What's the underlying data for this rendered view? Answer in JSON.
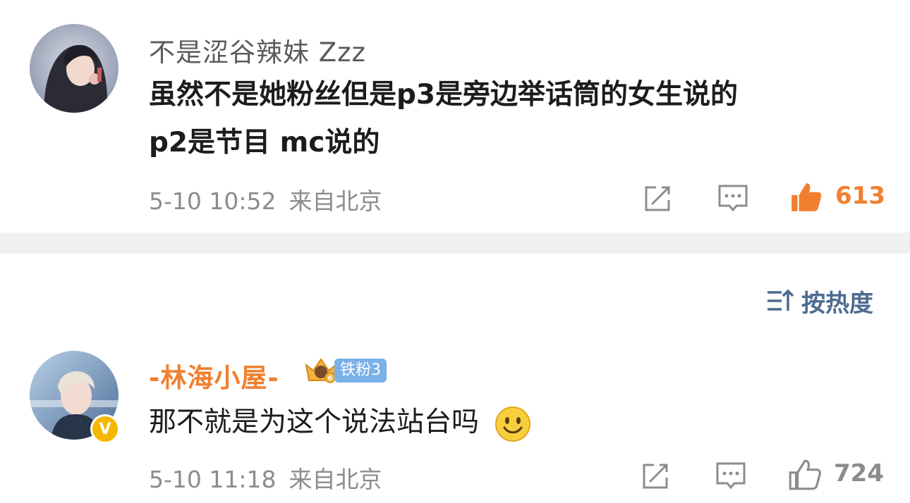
{
  "comments": [
    {
      "username": "不是涩谷辣妹 Zzz",
      "text_lines": [
        "虽然不是她粉丝但是p3是旁边举话筒的女生说的",
        "p2是节目 mc说的"
      ],
      "time": "5-10 10:52",
      "location": "来自北京",
      "likes": "613",
      "liked": true
    },
    {
      "username": "-林海小屋-",
      "badge_level": "6",
      "badge_label": "铁粉3",
      "verified": true,
      "text": "那不就是为这个说法站台吗",
      "time": "5-10 11:18",
      "location": "来自北京",
      "likes": "724",
      "liked": false
    }
  ],
  "sort_label": "按热度",
  "colors": {
    "liked": "#f0802f",
    "icon_gray": "#8c8c8c",
    "sort_blue": "#4d6b8f",
    "vip_name": "#f0802f"
  },
  "icons": [
    "share-icon",
    "comment-icon",
    "like-icon",
    "sort-icon",
    "smile-emoji-icon",
    "verified-icon",
    "fan-crown-icon"
  ]
}
